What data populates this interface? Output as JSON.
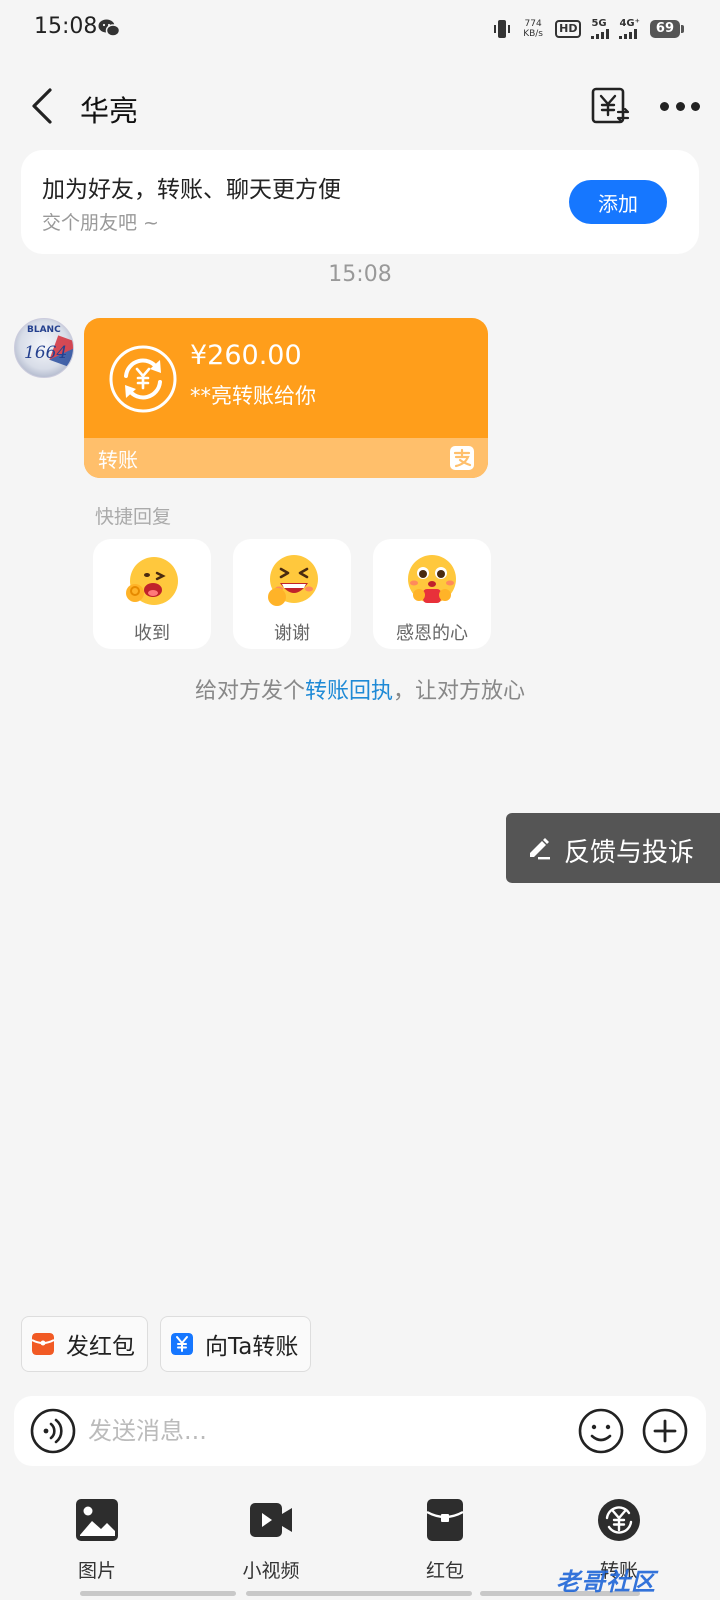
{
  "status_bar": {
    "time": "15:08",
    "net_speed": "774",
    "net_unit": "KB/s",
    "hd": "HD",
    "signal1": "5G",
    "signal2": "4G⁺",
    "battery": "69"
  },
  "header": {
    "title": "华亮"
  },
  "add_friend": {
    "title": "加为好友，转账、聊天更方便",
    "subtitle": "交个朋友吧 ~",
    "button_label": "添加"
  },
  "timestamp": "15:08",
  "avatar": {
    "line1": "BLANC",
    "line2": "1664"
  },
  "transfer": {
    "amount": "¥260.00",
    "description": "**亮转账给你",
    "footer_label": "转账"
  },
  "quick_reply": {
    "label": "快捷回复",
    "items": [
      {
        "label": "收到"
      },
      {
        "label": "谢谢"
      },
      {
        "label": "感恩的心"
      }
    ]
  },
  "receipt": {
    "prefix": "给对方发个",
    "link": "转账回执",
    "suffix": "，让对方放心"
  },
  "feedback": {
    "label": "反馈与投诉"
  },
  "shortcuts": [
    {
      "label": "发红包"
    },
    {
      "label": "向Ta转账"
    }
  ],
  "input": {
    "placeholder": "发送消息..."
  },
  "toolbar": [
    {
      "label": "图片"
    },
    {
      "label": "小视频"
    },
    {
      "label": "红包"
    },
    {
      "label": "转账"
    }
  ],
  "watermark": "老哥社区",
  "colors": {
    "accent_blue": "#1677ff",
    "transfer_orange": "#ff9e1b",
    "transfer_footer": "#ffbf6b",
    "link_blue": "#1f8ad6",
    "red_packet": "#f15a24"
  }
}
